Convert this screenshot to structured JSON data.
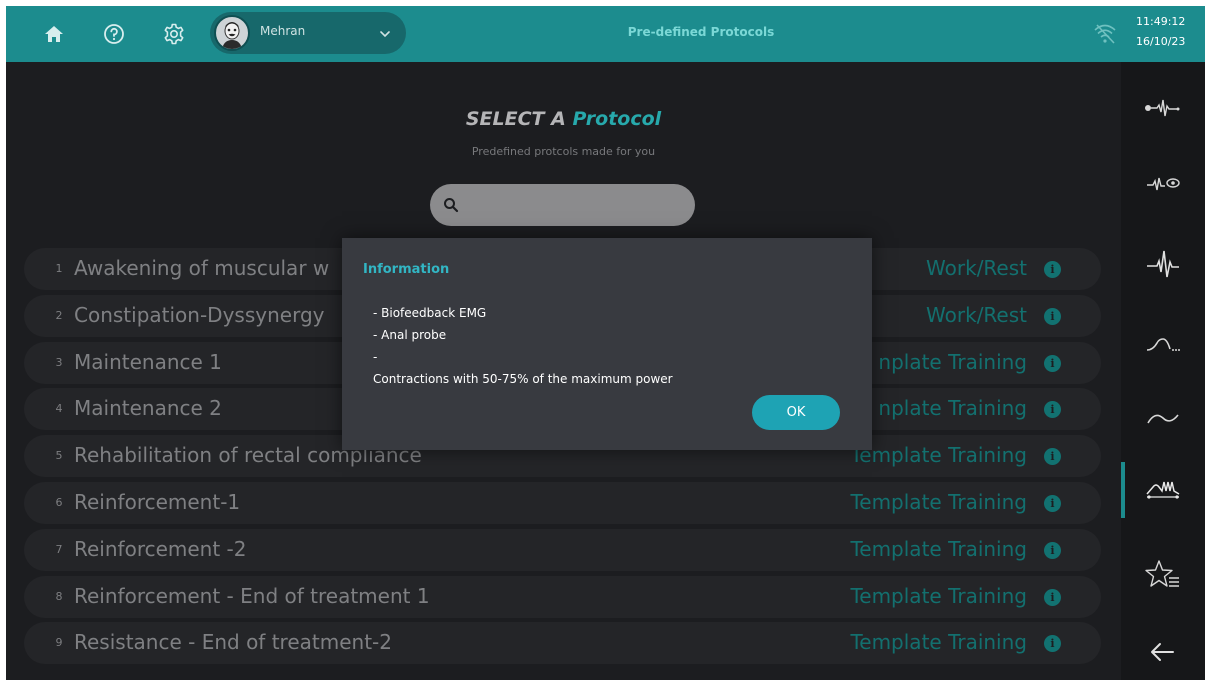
{
  "header": {
    "home_icon": "home-icon",
    "help_icon": "help-icon",
    "settings_icon": "gear-icon",
    "user": {
      "name": "Mehran",
      "avatar": "avatar"
    },
    "title": "Pre-defined Protocols",
    "wifi_icon": "wifi-off-icon",
    "time": "11:49:12",
    "date": "16/10/23"
  },
  "main": {
    "heading_prefix": "SELECT A",
    "heading_accent": "Protocol",
    "subheading": "Predefined protcols made for you",
    "search": {
      "value": "",
      "placeholder": ""
    }
  },
  "protocols": [
    {
      "num": "1",
      "name": "Awakening of muscular w",
      "type": "Work/Rest"
    },
    {
      "num": "2",
      "name": "Constipation-Dyssynergy",
      "type": "Work/Rest"
    },
    {
      "num": "3",
      "name": "Maintenance 1",
      "type": "nplate Training"
    },
    {
      "num": "4",
      "name": "Maintenance 2",
      "type": "nplate Training"
    },
    {
      "num": "5",
      "name": "Rehabilitation of rectal compliance",
      "type": "Template Training"
    },
    {
      "num": "6",
      "name": "Reinforcement-1",
      "type": "Template Training"
    },
    {
      "num": "7",
      "name": "Reinforcement -2",
      "type": "Template Training"
    },
    {
      "num": "8",
      "name": "Reinforcement - End of treatment 1",
      "type": "Template Training"
    },
    {
      "num": "9",
      "name": "Resistance - End of treatment-2",
      "type": "Template Training"
    }
  ],
  "info_glyph": "i",
  "modal": {
    "title": "Information",
    "lines": [
      "- Biofeedback EMG",
      "- Anal probe",
      "-",
      "Contractions with 50-75% of the maximum power"
    ],
    "ok_label": "OK"
  },
  "sidebar": {
    "items": [
      {
        "icon": "emg-probe-icon"
      },
      {
        "icon": "emg-eye-icon"
      },
      {
        "icon": "emg-signal-icon"
      },
      {
        "icon": "curve-dots-icon"
      },
      {
        "icon": "wave-icon"
      },
      {
        "icon": "template-training-icon",
        "active": true
      },
      {
        "icon": "favorites-list-icon"
      },
      {
        "icon": "back-arrow-icon"
      }
    ]
  },
  "colors": {
    "accent": "#1c8c8e",
    "accent_text": "#27a9ac",
    "modal_button": "#1ea3b4",
    "background": "#1c1d20"
  }
}
